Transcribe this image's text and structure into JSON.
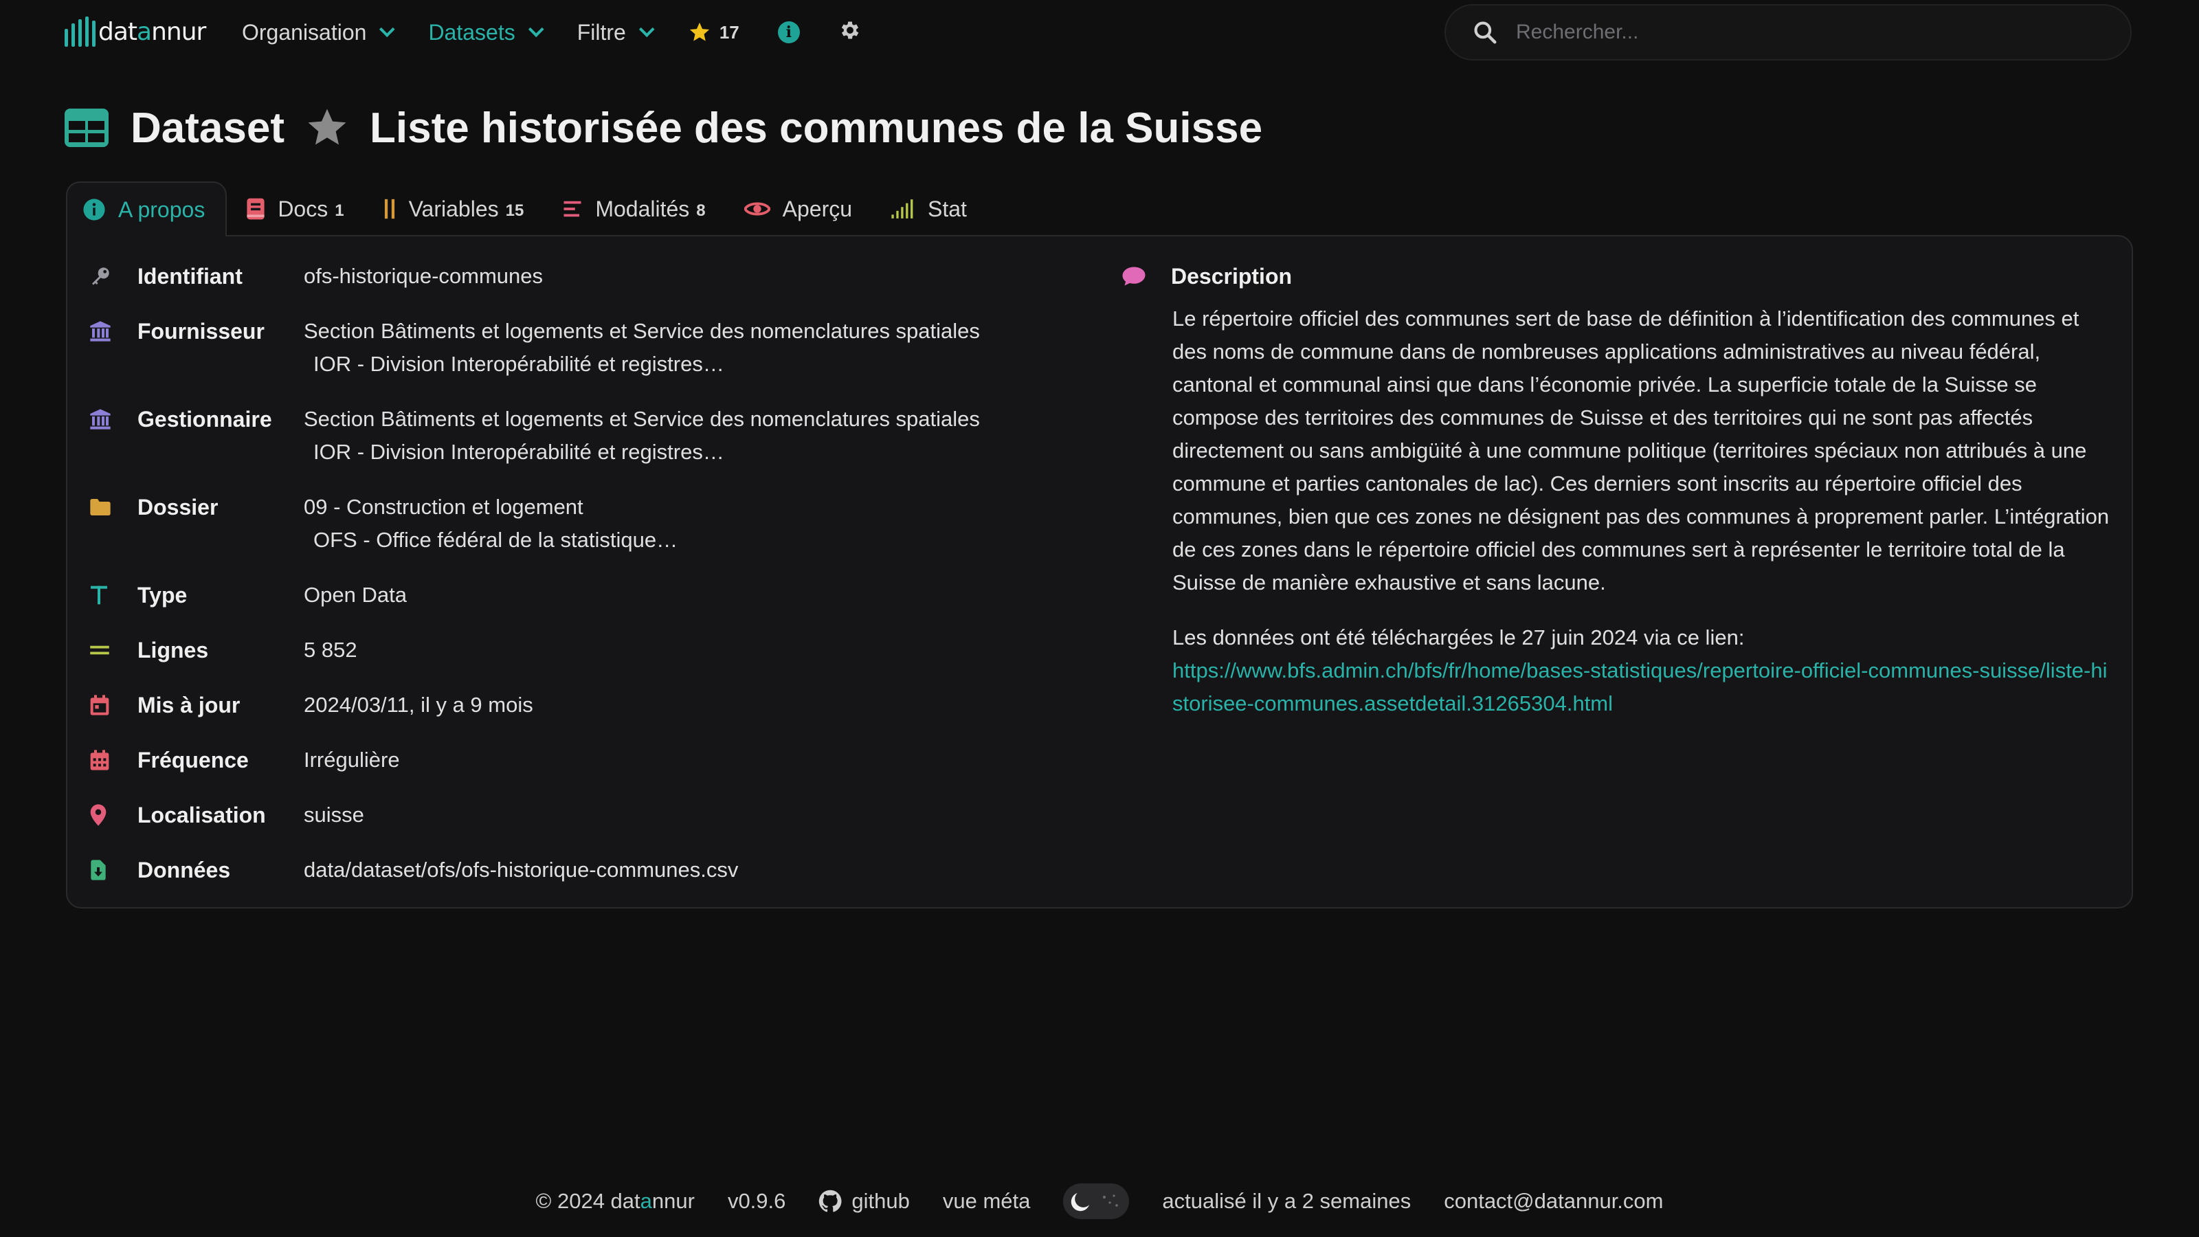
{
  "brand": {
    "logo_text_1": "dat",
    "logo_text_accent": "a",
    "logo_text_2": "nnur"
  },
  "nav": {
    "organisation": "Organisation",
    "datasets": "Datasets",
    "filtre": "Filtre",
    "favorites_count": "17"
  },
  "search": {
    "placeholder": "Rechercher..."
  },
  "title": {
    "kind": "Dataset",
    "name": "Liste historisée des communes de la Suisse"
  },
  "tabs": [
    {
      "label": "A propos",
      "count": ""
    },
    {
      "label": "Docs",
      "count": "1"
    },
    {
      "label": "Variables",
      "count": "15"
    },
    {
      "label": "Modalités",
      "count": "8"
    },
    {
      "label": "Aperçu",
      "count": ""
    },
    {
      "label": "Stat",
      "count": ""
    }
  ],
  "properties": {
    "identifiant": {
      "label": "Identifiant",
      "value": "ofs-historique-communes"
    },
    "fournisseur": {
      "label": "Fournisseur",
      "value": "Section Bâtiments et logements et Service des nomenclatures spatiales",
      "sub": "IOR - Division Interopérabilité et registres…"
    },
    "gestionnaire": {
      "label": "Gestionnaire",
      "value": "Section Bâtiments et logements et Service des nomenclatures spatiales",
      "sub": "IOR - Division Interopérabilité et registres…"
    },
    "dossier": {
      "label": "Dossier",
      "value": "09 - Construction et logement",
      "sub": "OFS - Office fédéral de la statistique…"
    },
    "type": {
      "label": "Type",
      "value": "Open Data"
    },
    "lignes": {
      "label": "Lignes",
      "value": "5 852"
    },
    "mis_a_jour": {
      "label": "Mis à jour",
      "value": "2024/03/11, il y a 9 mois"
    },
    "frequence": {
      "label": "Fréquence",
      "value": "Irrégulière"
    },
    "localisation": {
      "label": "Localisation",
      "value": "suisse"
    },
    "donnees": {
      "label": "Données",
      "value": "data/dataset/ofs/ofs-historique-communes.csv"
    }
  },
  "description": {
    "label": "Description",
    "paragraph": "Le répertoire officiel des communes sert de base de définition à l’identification des communes et des noms de commune dans de nombreuses applications administratives au niveau fédéral, cantonal et communal ainsi que dans l’économie privée. La superficie totale de la Suisse se compose des territoires des communes de Suisse et des territoires qui ne sont pas affectés directement ou sans ambigüité à une commune politique (territoires spéciaux non attribués à une commune et parties cantonales de lac). Ces derniers sont inscrits au répertoire officiel des communes, bien que ces zones ne désignent pas des communes à proprement parler. L’intégration de ces zones dans le répertoire officiel des communes sert à représenter le territoire total de la Suisse de manière exhaustive et sans lacune.",
    "download_text": "Les données ont été téléchargées le 27 juin 2024 via ce lien:",
    "link": "https://www.bfs.admin.ch/bfs/fr/home/bases-statistiques/repertoire-officiel-communes-suisse/liste-historisee-communes.assetdetail.31265304.html"
  },
  "footer": {
    "copyright": "© 2024 dat",
    "copyright_accent": "a",
    "copyright_end": "nnur",
    "version": "v0.9.6",
    "github": "github",
    "meta_view": "vue méta",
    "updated": "actualisé il y a 2 semaines",
    "contact": "contact@datannur.com"
  },
  "colors": {
    "accent": "#2ab3a8",
    "background": "#0f0f10",
    "panel": "#151517",
    "star": "#f2c21b",
    "icon_provider": "#8b7fd6",
    "icon_folder": "#d7a13b",
    "icon_calendar": "#e35d6a",
    "icon_location": "#e35d7a",
    "icon_lines": "#b8c94a",
    "icon_description": "#e06ab8",
    "icon_data": "#3fb07a"
  }
}
